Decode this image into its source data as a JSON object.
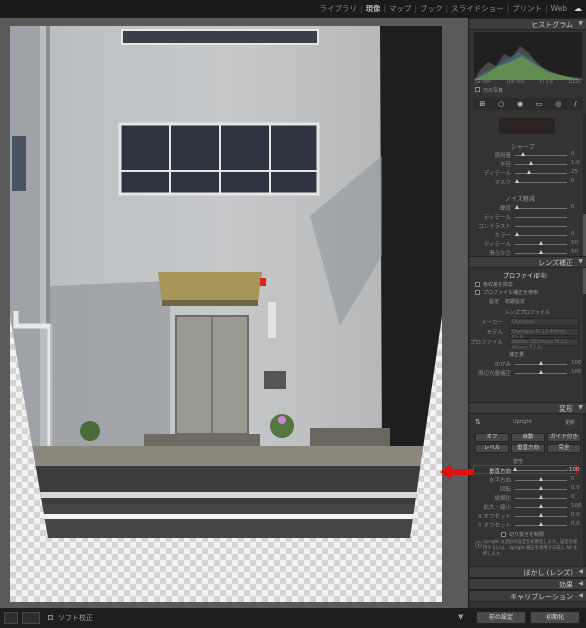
{
  "modules": [
    "ライブラリ",
    "現像",
    "マップ",
    "ブック",
    "スライドショー",
    "プリント",
    "Web"
  ],
  "active_module": "現像",
  "histogram": {
    "title": "ヒストグラム",
    "readout": [
      "52 mm",
      "100 mm",
      "f / 5.6",
      "1/125"
    ],
    "original_label": "元の写真"
  },
  "sharpening": {
    "title": "シャープ",
    "rows": [
      {
        "label": "適用量",
        "value": "0"
      },
      {
        "label": "半径",
        "value": "1.0"
      },
      {
        "label": "ディテール",
        "value": "25"
      },
      {
        "label": "マスク",
        "value": "0"
      }
    ]
  },
  "noise": {
    "title": "ノイズ軽減",
    "rows": [
      {
        "label": "輝度",
        "value": "0"
      },
      {
        "label": "ディテール",
        "value": ""
      },
      {
        "label": "コントラスト",
        "value": ""
      },
      {
        "label": "カラー",
        "value": "0"
      },
      {
        "label": "ディテール",
        "value": "50"
      },
      {
        "label": "滑らかさ",
        "value": "50"
      }
    ]
  },
  "lens": {
    "title": "レンズ補正",
    "tabs": [
      "プロファイル",
      "手動"
    ],
    "checks": [
      "色収差を除去",
      "プロファイル補正を使用"
    ],
    "setup_label": "設定",
    "setup_value": "初期設定",
    "profile_title": "レンズプロファイル",
    "maker_label": "メーカー",
    "model_label": "モデル",
    "profile_label": "プロファイル",
    "maker_value": "Olympus",
    "model_value": "Olympus M.12-40mm F2.8",
    "profile_value": "Adobe (Olympus M.12-40mm F2.8)",
    "amount_title": "補正量",
    "amount_rows": [
      {
        "label": "ゆがみ",
        "value": "100"
      },
      {
        "label": "周辺光量補正",
        "value": "100"
      }
    ]
  },
  "transform": {
    "title": "変形",
    "upright_label": "Upright",
    "reset_label": "更新",
    "buttons_row1": [
      "オフ",
      "自動",
      "ガイド付き"
    ],
    "buttons_row2": [
      "レベル",
      "垂直方向",
      "完全"
    ],
    "section_label": "変形",
    "rows": [
      {
        "label": "垂直方向",
        "value": "-100"
      },
      {
        "label": "水平方向",
        "value": "0"
      },
      {
        "label": "回転",
        "value": "0.0"
      },
      {
        "label": "縦横比",
        "value": "0"
      },
      {
        "label": "拡大・縮小",
        "value": "100"
      },
      {
        "label": "X オフセット",
        "value": "0.0"
      },
      {
        "label": "Y オフセット",
        "value": "0.0"
      }
    ],
    "crop_label": "切り抜きを制限",
    "note": "Upright は変形の設定を初期化します。設定を保持するには、Upright 補正を適用する前に Alt を押します。"
  },
  "collapsed_panels": [
    "ぼかし (レンズ)",
    "効果",
    "キャリブレーション"
  ],
  "footer": {
    "prev_button": "前の設定",
    "reset_button": "初期化",
    "toolbar_label": "ソフト校正"
  }
}
